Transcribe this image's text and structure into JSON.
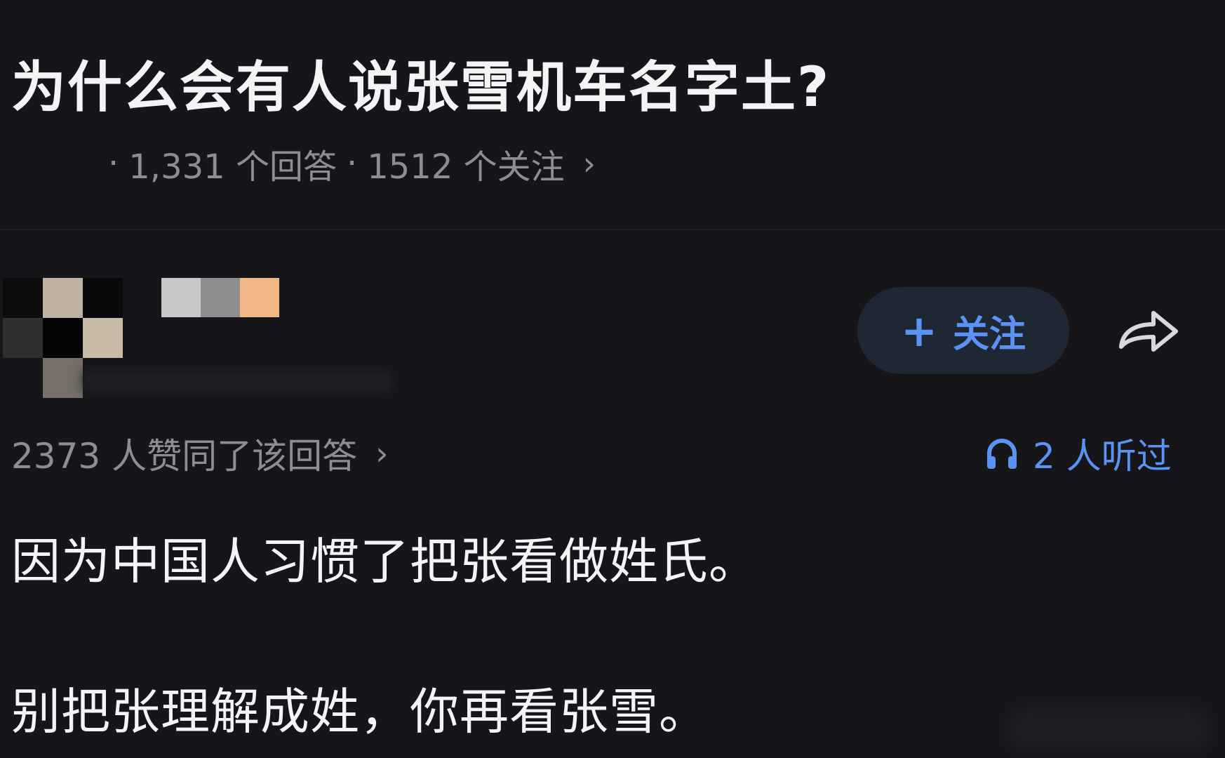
{
  "question": {
    "title": "为什么会有人说张雪机车名字土?",
    "meta_separator": "·",
    "answers_text": "1,331 个回答",
    "followers_text": "1512 个关注",
    "chevron": "›"
  },
  "author": {
    "avatar_colors": [
      "#0d0d0d",
      "#bfb2a2",
      "#0a0a0a",
      "#2e302d",
      "#050505",
      "#c8baa7",
      "#16161a",
      "#777068",
      "#16161a"
    ],
    "name_colors": [
      "#c7c7c7",
      "#8e8f8f",
      "#f2b685"
    ]
  },
  "follow_button": {
    "plus": "+",
    "label": "关注"
  },
  "share": {
    "icon": "share-icon"
  },
  "approval": {
    "text": "2373 人赞同了该回答",
    "chevron": "›"
  },
  "listen": {
    "icon": "headphones-icon",
    "text": "2 人听过"
  },
  "answer": {
    "paragraphs": [
      "因为中国人习惯了把张看做姓氏。",
      "别把张理解成姓，你再看张雪。"
    ]
  },
  "colors": {
    "background": "#16161a",
    "accent": "#5b93f4",
    "secondary_text": "#8c8e96",
    "button_bg": "#1f2735"
  }
}
